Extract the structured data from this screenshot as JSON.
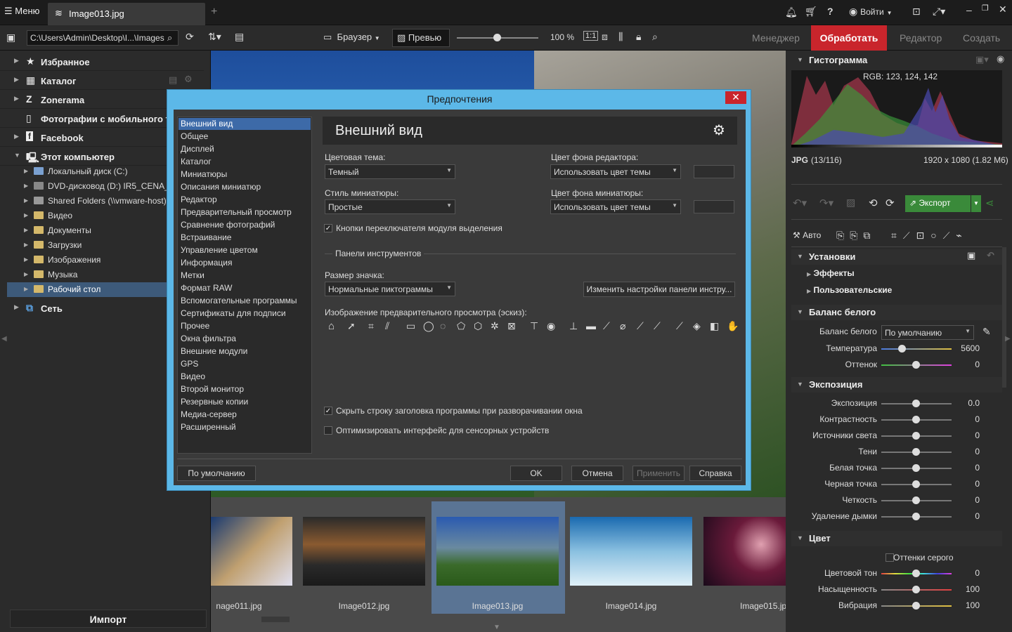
{
  "app": {
    "menu_label": "Меню",
    "tab_title": "Image013.jpg",
    "login": "Войти"
  },
  "toolbar": {
    "path": "C:\\Users\\Admin\\Desktop\\I...\\Images",
    "browser": "Браузер",
    "preview": "Превью",
    "zoom": "100 %",
    "modes": [
      "Менеджер",
      "Обработать",
      "Редактор",
      "Создать"
    ]
  },
  "nav": {
    "top": [
      {
        "label": "Избранное",
        "icon": "star-icon"
      },
      {
        "label": "Каталог",
        "icon": "catalog-icon"
      },
      {
        "label": "Zonerama",
        "icon": "zonerama-icon"
      },
      {
        "label": "Фотографии с мобильного т",
        "icon": "mobile-icon"
      },
      {
        "label": "Facebook",
        "icon": "facebook-icon"
      },
      {
        "label": "Этот компьютер",
        "icon": "computer-icon"
      }
    ],
    "children": [
      "Локальный диск (C:)",
      "DVD-дисковод (D:) IR5_CENA_X",
      "Shared Folders (\\\\vmware-host)",
      "Видео",
      "Документы",
      "Загрузки",
      "Изображения",
      "Музыка",
      "Рабочий стол"
    ],
    "network": "Сеть",
    "import": "Импорт"
  },
  "filmstrip": [
    {
      "name": "nage011.jpg"
    },
    {
      "name": "Image012.jpg"
    },
    {
      "name": "Image013.jpg"
    },
    {
      "name": "Image014.jpg"
    },
    {
      "name": "Image015.jp"
    }
  ],
  "right": {
    "histogram_title": "Гистограмма",
    "rgb": "RGB: 123, 124, 142",
    "format": "JPG",
    "index": "(13/116)",
    "dims": "1920 x 1080 (1.82 М6)",
    "export": "Экспорт",
    "auto": "Авто",
    "settings": "Установки",
    "effects": "Эффекты",
    "user": "Пользовательские",
    "wb_title": "Баланс белого",
    "wb_label": "Баланс белого",
    "wb_value": "По умолчанию",
    "temp": {
      "label": "Температура",
      "value": "5600"
    },
    "tint": {
      "label": "Оттенок",
      "value": "0"
    },
    "exposure_title": "Экспозиция",
    "exposure": [
      {
        "label": "Экспозиция",
        "value": "0.0"
      },
      {
        "label": "Контрастность",
        "value": "0"
      },
      {
        "label": "Источники света",
        "value": "0"
      },
      {
        "label": "Тени",
        "value": "0"
      },
      {
        "label": "Белая точка",
        "value": "0"
      },
      {
        "label": "Черная точка",
        "value": "0"
      },
      {
        "label": "Четкость",
        "value": "0"
      },
      {
        "label": "Удаление дымки",
        "value": "0"
      }
    ],
    "color_title": "Цвет",
    "grayscale": "Оттенки серого",
    "color": [
      {
        "label": "Цветовой тон",
        "value": "0"
      },
      {
        "label": "Насыщенность",
        "value": "100"
      },
      {
        "label": "Вибрация",
        "value": "100"
      }
    ]
  },
  "dialog": {
    "title": "Предпочтения",
    "categories": [
      "Внешний вид",
      "Общее",
      "Дисплей",
      "Каталог",
      "Миниатюры",
      "Описания миниатюр",
      "Редактор",
      "Предварительный просмотр",
      "Сравнение фотографий",
      "Встраивание",
      "Управление цветом",
      "Информация",
      "Метки",
      "Формат RAW",
      "Вспомогательные программы",
      "Сертификаты для подписи",
      "Прочее",
      "Окна фильтра",
      "Внешние модули",
      "GPS",
      "Видео",
      "Второй монитор",
      "Резервные копии",
      "Медиа-сервер",
      "Расширенный"
    ],
    "heading": "Внешний вид",
    "theme_label": "Цветовая тема:",
    "theme_value": "Темный",
    "editor_bg_label": "Цвет фона редактора:",
    "editor_bg_value": "Использовать цвет темы",
    "thumb_style_label": "Стиль миниатюры:",
    "thumb_style_value": "Простые",
    "thumb_bg_label": "Цвет фона миниатюры:",
    "thumb_bg_value": "Использовать цвет темы",
    "module_switch": "Кнопки переключателя модуля выделения",
    "toolbars": "Панели инструментов",
    "icon_size_label": "Размер значка:",
    "icon_size_value": "Нормальные пиктограммы",
    "change_toolbar": "Изменить настройки панели инстру...",
    "preview_label": "Изображение предварительного просмотра (эскиз):",
    "hide_title": "Скрыть строку заголовка программы при разворачивании окна",
    "touch": "Оптимизировать интерфейс для сенсорных устройств",
    "default_btn": "По умолчанию",
    "ok": "OK",
    "cancel": "Отмена",
    "apply": "Применить",
    "help": "Справка"
  }
}
